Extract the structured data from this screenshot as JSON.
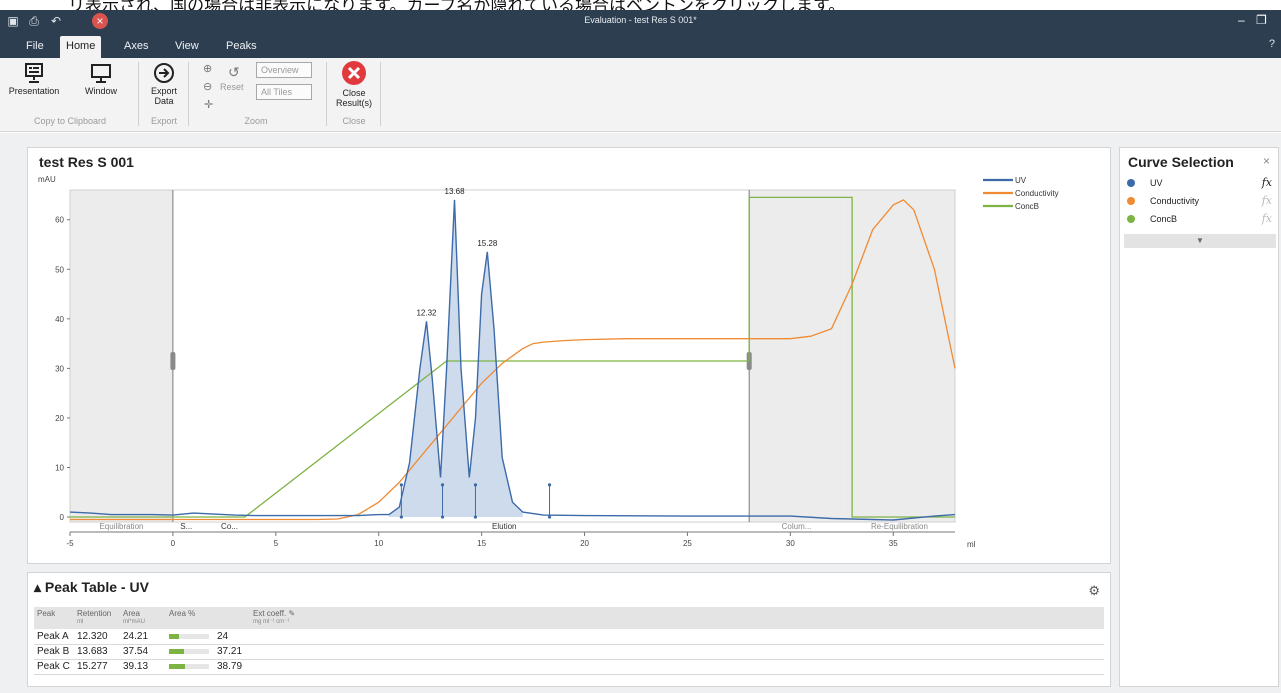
{
  "caption": "リ表示され、国の場合は非表示になります。カーブ名が隠れている場合はベントンをクリックします。",
  "window": {
    "title": "Evaluation - test Res S 001*"
  },
  "tabs": [
    "File",
    "Home",
    "Axes",
    "View",
    "Peaks"
  ],
  "ribbon": {
    "presentation": "Presentation",
    "window": "Window",
    "copy_group": "Copy to Clipboard",
    "export_line1": "Export",
    "export_line2": "Data",
    "export_group": "Export",
    "reset": "Reset",
    "overview": "Overview",
    "all_tiles": "All Tiles",
    "zoom_group": "Zoom",
    "close_line1": "Close",
    "close_line2": "Result(s)",
    "close_group": "Close"
  },
  "chart_panel": {
    "title": "test Res S 001"
  },
  "colors": {
    "uv": "#3d6aa8",
    "uv_fill": "#c6d5ea",
    "conductivity": "#f08a33",
    "concb": "#7cb342",
    "ribbon_bg": "#f3f3f3",
    "titlebar_bg": "#2c3e50"
  },
  "chart_data": {
    "type": "line",
    "ylabel": "mAU",
    "xlabel": "ml",
    "xlim": [
      -5,
      38
    ],
    "ylim": [
      -1,
      66
    ],
    "x_ticks": [
      -5,
      0,
      5,
      10,
      15,
      20,
      25,
      30,
      35
    ],
    "y_ticks": [
      0,
      10,
      20,
      30,
      40,
      50,
      60
    ],
    "legend_position": "top-right",
    "series": [
      {
        "name": "UV",
        "x": [
          -5,
          -4,
          -3,
          -2,
          -1,
          0,
          1,
          2,
          3,
          4,
          5,
          6,
          7,
          8,
          9,
          10,
          10.5,
          11,
          11.5,
          12,
          12.32,
          12.6,
          13,
          13.3,
          13.683,
          14.0,
          14.4,
          14.7,
          15.0,
          15.277,
          15.6,
          16.0,
          16.5,
          17,
          18,
          20,
          25,
          28,
          30,
          32,
          35,
          37,
          38
        ],
        "y": [
          1,
          0.8,
          0.5,
          0.5,
          0.5,
          0.4,
          0.8,
          0.6,
          0.4,
          0.3,
          0.3,
          0.3,
          0.3,
          0.3,
          0.3,
          0.5,
          0.5,
          2,
          11,
          30,
          39.5,
          28,
          8,
          30,
          64,
          30,
          8,
          20,
          45,
          53.5,
          38,
          12,
          3,
          1,
          0.4,
          0.3,
          0.2,
          0.2,
          0.2,
          -0.3,
          -0.6,
          0.2,
          0.5
        ]
      },
      {
        "name": "Conductivity",
        "x": [
          -5,
          0,
          5,
          7,
          8,
          9,
          10,
          11,
          12,
          13,
          14,
          15,
          16,
          17,
          17.5,
          18,
          19,
          20,
          22,
          25,
          28,
          30,
          31,
          32,
          33,
          34,
          35,
          35.5,
          36,
          37,
          38
        ],
        "y": [
          -0.5,
          -0.5,
          -0.5,
          -0.5,
          -0.4,
          0.5,
          3,
          7,
          12,
          17,
          22,
          27,
          31,
          34,
          35,
          35.3,
          35.6,
          35.8,
          36,
          36,
          36,
          36,
          36.5,
          38,
          47,
          58,
          63,
          64,
          62,
          50,
          30
        ]
      },
      {
        "name": "ConcB",
        "x": [
          -5,
          3.5,
          13.3,
          28,
          28,
          33,
          33,
          38
        ],
        "y": [
          0,
          0,
          31.5,
          31.5,
          64.5,
          64.5,
          0,
          0
        ]
      }
    ],
    "peak_labels": [
      {
        "x": 12.32,
        "y": 39.5,
        "text": "12.32"
      },
      {
        "x": 13.683,
        "y": 64,
        "text": "13.68"
      },
      {
        "x": 15.277,
        "y": 53.5,
        "text": "15.28"
      }
    ],
    "peak_markers_x": [
      11.1,
      13.1,
      14.7,
      18.3
    ],
    "regions": [
      {
        "from": -5,
        "to": 0,
        "label": "Equilibration",
        "shaded": true
      },
      {
        "from": 0,
        "to": 1.3,
        "label": "S...",
        "shaded": false
      },
      {
        "from": 1.3,
        "to": 4.2,
        "label": "Co...",
        "shaded": false
      },
      {
        "from": 4.2,
        "to": 28,
        "label": "Elution",
        "shaded": false
      },
      {
        "from": 28,
        "to": 32.6,
        "label": "Colum...",
        "shaded": true
      },
      {
        "from": 32.6,
        "to": 38,
        "label": "Re-Equilibration",
        "shaded": true
      }
    ]
  },
  "peak_table": {
    "title": "Peak Table - UV",
    "headers": [
      {
        "label": "Peak",
        "unit": ""
      },
      {
        "label": "Retention",
        "unit": "ml"
      },
      {
        "label": "Area",
        "unit": "ml*mAU"
      },
      {
        "label": "Area %",
        "unit": ""
      },
      {
        "label": "Ext coeff.",
        "unit": "mg ml⁻¹ cm⁻¹"
      }
    ],
    "rows": [
      {
        "peak": "Peak A",
        "retention": "12.320",
        "area": "24.21",
        "area_pct": "24",
        "area_pct_value": 24
      },
      {
        "peak": "Peak B",
        "retention": "13.683",
        "area": "37.54",
        "area_pct": "37.21",
        "area_pct_value": 37.21
      },
      {
        "peak": "Peak C",
        "retention": "15.277",
        "area": "39.13",
        "area_pct": "38.79",
        "area_pct_value": 38.79
      }
    ]
  },
  "curve_selection": {
    "title": "Curve Selection",
    "items": [
      {
        "label": "UV",
        "color": "#3d6aa8",
        "active": true
      },
      {
        "label": "Conductivity",
        "color": "#f08a33",
        "active": false
      },
      {
        "label": "ConcB",
        "color": "#7cb342",
        "active": false
      }
    ]
  }
}
